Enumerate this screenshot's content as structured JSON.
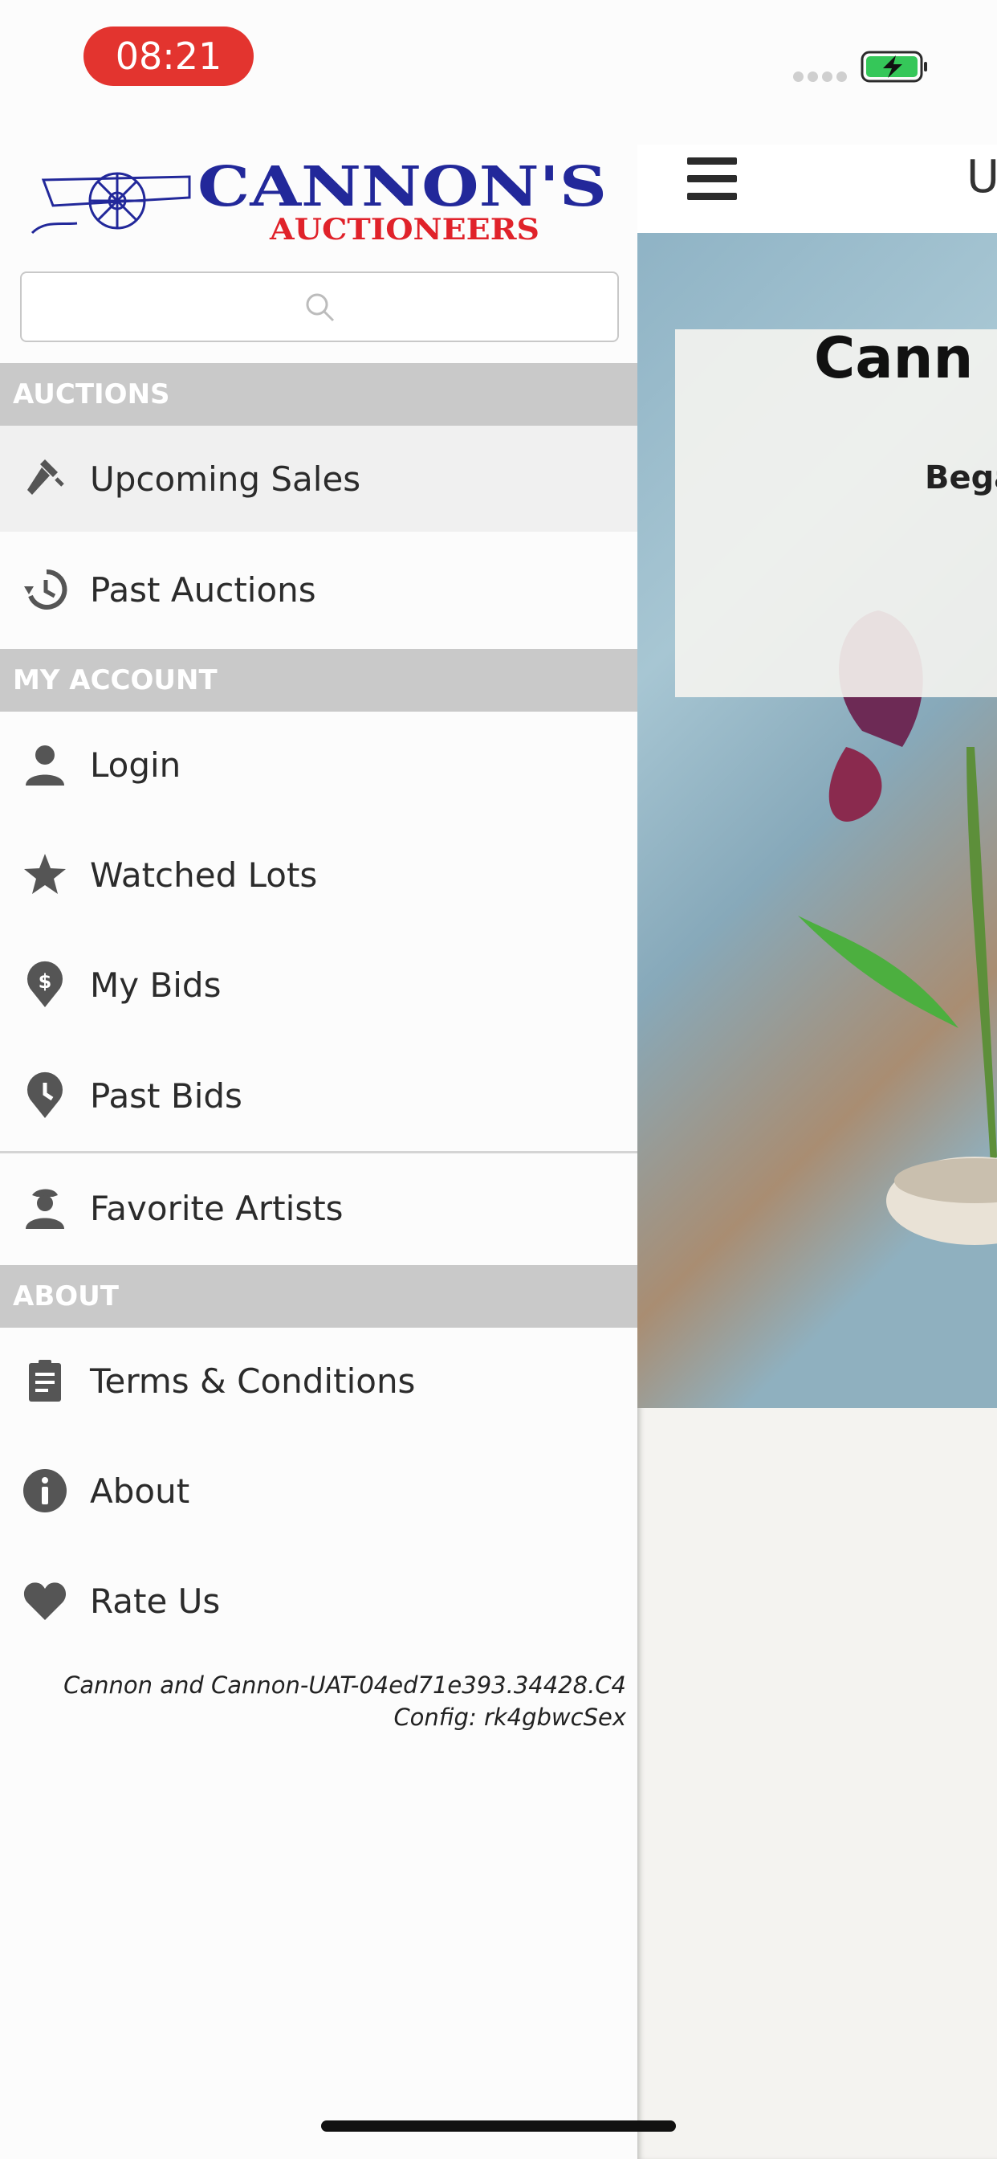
{
  "status_bar": {
    "time": "08:21"
  },
  "brand": {
    "name": "CANNON'S",
    "tagline": "AUCTIONEERS",
    "name_color": "#22289a",
    "tagline_color": "#e0222a"
  },
  "search": {
    "placeholder": ""
  },
  "sections": {
    "auctions": "AUCTIONS",
    "my_account": "MY ACCOUNT",
    "about": "ABOUT"
  },
  "menu": {
    "upcoming_sales": "Upcoming Sales",
    "past_auctions": "Past Auctions",
    "login": "Login",
    "watched_lots": "Watched Lots",
    "my_bids": "My Bids",
    "past_bids": "Past Bids",
    "favorite_artists": "Favorite Artists",
    "terms": "Terms & Conditions",
    "about": "About",
    "rate_us": "Rate Us"
  },
  "version": {
    "build": "Cannon and Cannon-UAT-04ed71e393.34428.C4",
    "config": "Config: rk4gbwcSex"
  },
  "main": {
    "header_title": "U",
    "hero_title": "Cann",
    "hero_subtitle": "Bega"
  },
  "colors": {
    "accent_red": "#e3342f",
    "section_gray": "#c9c9c9",
    "icon_gray": "#555555"
  }
}
